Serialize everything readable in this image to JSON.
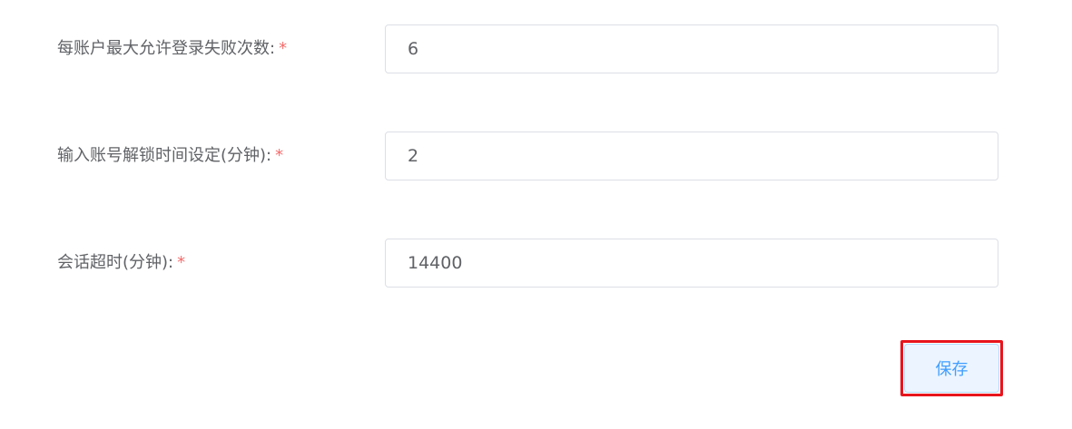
{
  "form": {
    "fields": [
      {
        "label": "每账户最大允许登录失败次数:",
        "required_mark": "*",
        "value": "6"
      },
      {
        "label": "输入账号解锁时间设定(分钟):",
        "required_mark": "*",
        "value": "2"
      },
      {
        "label": "会话超时(分钟):",
        "required_mark": "*",
        "value": "14400"
      }
    ],
    "save_label": "保存"
  },
  "colors": {
    "label_text": "#606266",
    "required_star": "#f56c6c",
    "input_border": "#dcdfe6",
    "button_bg": "#ecf5ff",
    "button_text": "#409eff",
    "highlight_box": "#e8141c"
  }
}
